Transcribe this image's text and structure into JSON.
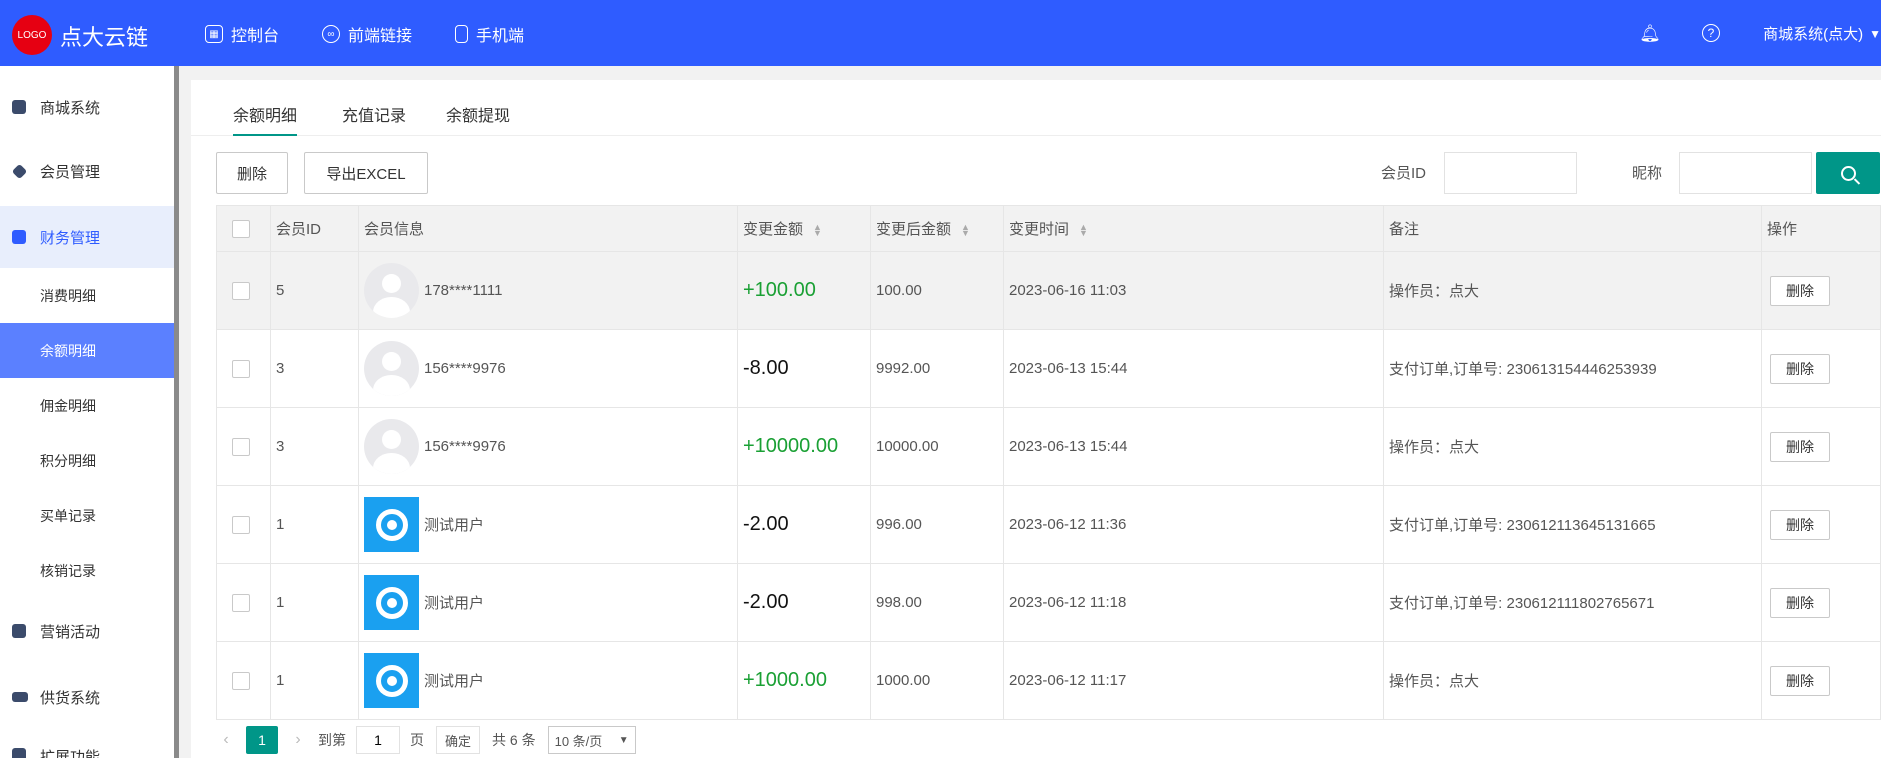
{
  "header": {
    "logo_text": "LOGO",
    "brand": "点大云链",
    "nav": [
      {
        "label": "控制台",
        "icon": "dashboard-icon"
      },
      {
        "label": "前端链接",
        "icon": "link-icon"
      },
      {
        "label": "手机端",
        "icon": "phone-icon"
      }
    ],
    "user": "商城系统(点大)",
    "colors": {
      "header_bg": "#2f5cff",
      "accent": "#009688",
      "logo_red": "#e60012"
    }
  },
  "sidebar": {
    "items": [
      {
        "label": "商城系统",
        "icon": "bag-icon"
      },
      {
        "label": "会员管理",
        "icon": "diamond-icon"
      },
      {
        "label": "财务管理",
        "icon": "wallet-icon"
      }
    ],
    "sub_items": [
      {
        "label": "消费明细"
      },
      {
        "label": "余额明细"
      },
      {
        "label": "佣金明细"
      },
      {
        "label": "积分明细"
      },
      {
        "label": "买单记录"
      },
      {
        "label": "核销记录"
      }
    ],
    "more_items": [
      {
        "label": "营销活动",
        "icon": "gift-icon"
      },
      {
        "label": "供货系统",
        "icon": "truck-icon"
      },
      {
        "label": "扩展功能",
        "icon": "puzzle-icon"
      }
    ]
  },
  "tabs": [
    {
      "label": "余额明细"
    },
    {
      "label": "充值记录"
    },
    {
      "label": "余额提现"
    }
  ],
  "toolbar": {
    "delete_label": "删除",
    "export_label": "导出EXCEL",
    "member_id_label": "会员ID",
    "member_id_value": "",
    "nickname_label": "昵称",
    "nickname_value": ""
  },
  "table": {
    "columns": [
      "会员ID",
      "会员信息",
      "变更金额",
      "变更后金额",
      "变更时间",
      "备注",
      "操作"
    ],
    "rows": [
      {
        "id": "5",
        "name": "178****1111",
        "avatar": "default",
        "change": "+100.00",
        "sign": "pos",
        "after": "100.00",
        "time": "2023-06-16 11:03",
        "remark": "操作员：点大",
        "action": "删除"
      },
      {
        "id": "3",
        "name": "156****9976",
        "avatar": "default",
        "change": "-8.00",
        "sign": "neg",
        "after": "9992.00",
        "time": "2023-06-13 15:44",
        "remark": "支付订单,订单号: 230613154446253939",
        "action": "删除"
      },
      {
        "id": "3",
        "name": "156****9976",
        "avatar": "default",
        "change": "+10000.00",
        "sign": "pos",
        "after": "10000.00",
        "time": "2023-06-13 15:44",
        "remark": "操作员：点大",
        "action": "删除"
      },
      {
        "id": "1",
        "name": "测试用户",
        "avatar": "brand",
        "change": "-2.00",
        "sign": "neg",
        "after": "996.00",
        "time": "2023-06-12 11:36",
        "remark": "支付订单,订单号: 230612113645131665",
        "action": "删除"
      },
      {
        "id": "1",
        "name": "测试用户",
        "avatar": "brand",
        "change": "-2.00",
        "sign": "neg",
        "after": "998.00",
        "time": "2023-06-12 11:18",
        "remark": "支付订单,订单号: 230612111802765671",
        "action": "删除"
      },
      {
        "id": "1",
        "name": "测试用户",
        "avatar": "brand",
        "change": "+1000.00",
        "sign": "pos",
        "after": "1000.00",
        "time": "2023-06-12 11:17",
        "remark": "操作员：点大",
        "action": "删除"
      }
    ]
  },
  "pager": {
    "current": "1",
    "goto_label": "到第",
    "goto_value": "1",
    "page_label": "页",
    "confirm": "确定",
    "total": "共 6 条",
    "per_page": "10 条/页"
  }
}
